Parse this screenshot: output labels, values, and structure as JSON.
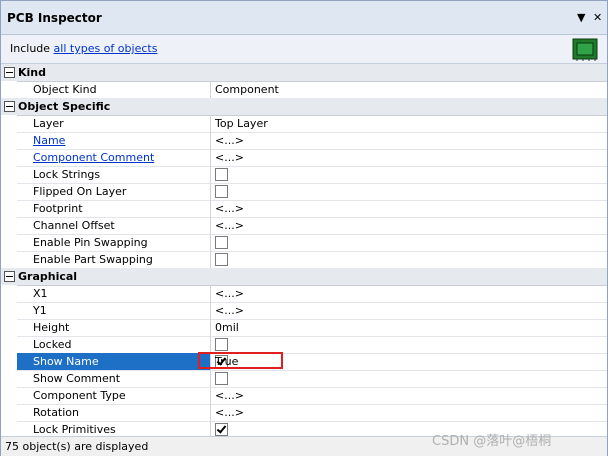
{
  "panel": {
    "title": "PCB Inspector",
    "dropdown_glyph": "▼",
    "close_glyph": "✕",
    "include_text": "Include",
    "include_link": "all types of objects",
    "chip_icon": "chip-icon"
  },
  "categories": [
    {
      "label": "Kind",
      "rows": [
        {
          "name": "Object Kind",
          "value": "Component",
          "kind": "text"
        }
      ]
    },
    {
      "label": "Object Specific",
      "rows": [
        {
          "name": "Layer",
          "value": "Top Layer",
          "kind": "text"
        },
        {
          "name": "Name",
          "value": "<...>",
          "kind": "text",
          "link": true
        },
        {
          "name": "Component Comment",
          "value": "<...>",
          "kind": "text",
          "link": true
        },
        {
          "name": "Lock Strings",
          "value": "",
          "kind": "check",
          "checked": false
        },
        {
          "name": "Flipped On Layer",
          "value": "",
          "kind": "check",
          "checked": false
        },
        {
          "name": "Footprint",
          "value": "<...>",
          "kind": "text"
        },
        {
          "name": "Channel Offset",
          "value": "<...>",
          "kind": "text"
        },
        {
          "name": "Enable Pin Swapping",
          "value": "",
          "kind": "check",
          "checked": false
        },
        {
          "name": "Enable Part Swapping",
          "value": "",
          "kind": "check",
          "checked": false
        }
      ]
    },
    {
      "label": "Graphical",
      "rows": [
        {
          "name": "X1",
          "value": "<...>",
          "kind": "text"
        },
        {
          "name": "Y1",
          "value": "<...>",
          "kind": "text"
        },
        {
          "name": "Height",
          "value": "0mil",
          "kind": "text"
        },
        {
          "name": "Locked",
          "value": "",
          "kind": "check",
          "checked": false
        },
        {
          "name": "Show Name",
          "value": "True",
          "kind": "check",
          "checked": true,
          "selected": true
        },
        {
          "name": "Show Comment",
          "value": "",
          "kind": "check",
          "checked": false
        },
        {
          "name": "Component Type",
          "value": "<...>",
          "kind": "text"
        },
        {
          "name": "Rotation",
          "value": "<...>",
          "kind": "text"
        },
        {
          "name": "Lock Primitives",
          "value": "",
          "kind": "check",
          "checked": true
        }
      ]
    }
  ],
  "status": {
    "text": "75 object(s) are displayed"
  },
  "watermark": "CSDN @落叶@梧桐",
  "colors": {
    "selection": "#1e6fc6",
    "highlight_box": "#e02020",
    "link": "#0033cc"
  }
}
